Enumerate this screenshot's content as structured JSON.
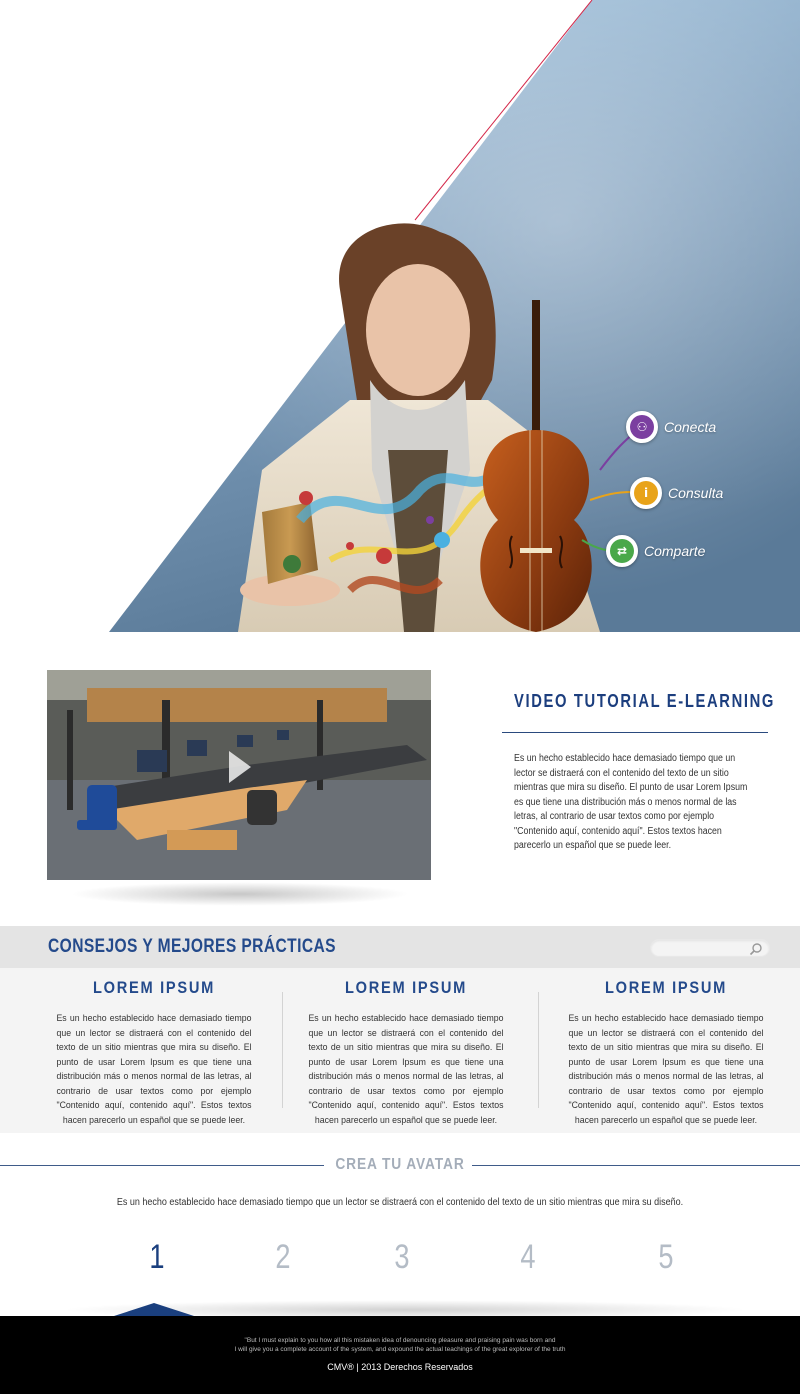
{
  "hero": {
    "bubbles": [
      {
        "label": "Conecta",
        "icon": "handshake-icon",
        "color": "#7b3fa0"
      },
      {
        "label": "Consulta",
        "icon": "info-icon",
        "color": "#e8a31a"
      },
      {
        "label": "Comparte",
        "icon": "share-icon",
        "color": "#4aa84a"
      }
    ]
  },
  "video": {
    "title": "VIDEO TUTORIAL E-LEARNING",
    "description": "Es un hecho establecido hace demasiado tiempo que un lector se distraerá con el contenido del texto de un sitio mientras que mira su diseño. El punto de usar Lorem Ipsum es que tiene una distribución más o menos normal de las letras, al contrario de usar textos como por ejemplo \"Contenido aquí, contenido aquí\". Estos textos hacen parecerlo un español que se puede leer."
  },
  "consejos": {
    "title": "CONSEJOS Y MEJORES PRÁCTICAS",
    "search_placeholder": "",
    "columns": [
      {
        "title": "LOREM IPSUM",
        "text": "Es un hecho establecido hace demasiado tiempo que un lector se distraerá con el contenido del texto de un sitio mientras que mira su diseño. El punto de usar Lorem Ipsum es que tiene una distribución más o menos normal de las letras, al contrario de usar textos como por ejemplo \"Contenido aquí, contenido aquí\". Estos textos hacen parecerlo un español que se puede leer."
      },
      {
        "title": "LOREM IPSUM",
        "text": "Es un hecho establecido hace demasiado tiempo que un lector se distraerá con el contenido del texto de un sitio mientras que mira su diseño. El punto de usar Lorem Ipsum es que tiene una distribución más o menos normal de las letras, al contrario de usar textos como por ejemplo \"Contenido aquí, contenido aquí\". Estos textos hacen parecerlo un español que se puede leer."
      },
      {
        "title": "LOREM IPSUM",
        "text": "Es un hecho establecido hace demasiado tiempo que un lector se distraerá con el contenido del texto de un sitio mientras que mira su diseño. El punto de usar Lorem Ipsum es que tiene una distribución más o menos normal de las letras, al contrario de usar textos como por ejemplo \"Contenido aquí, contenido aquí\". Estos textos hacen parecerlo un español que se puede leer."
      }
    ]
  },
  "avatar": {
    "title": "CREA TU AVATAR",
    "description": "Es un hecho establecido hace demasiado tiempo que un lector se distraerá con el contenido del texto de un sitio mientras que mira su diseño.",
    "steps": [
      "1",
      "2",
      "3",
      "4",
      "5"
    ],
    "active_step": 1
  },
  "footer": {
    "quote_line1": "\"But I must explain to you how all this mistaken idea of denouncing pleasure and praising pain was born and",
    "quote_line2": "I will give you a complete account of the system, and expound the actual teachings of the great explorer of the truth",
    "copyright": "CMV® | 2013 Derechos Reservados"
  },
  "colors": {
    "brand_blue": "#1c3e7e",
    "hero_blue": "#7f9fbd"
  }
}
